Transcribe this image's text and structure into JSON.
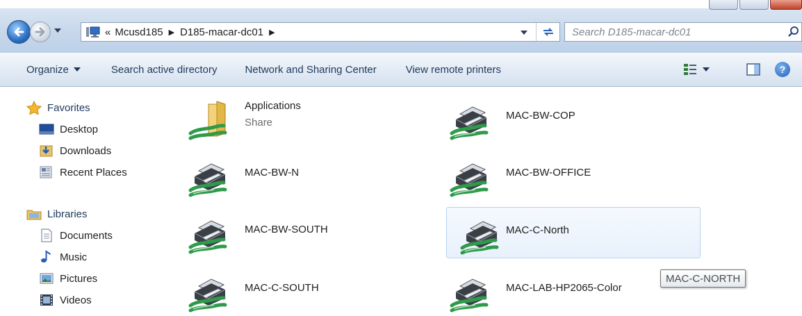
{
  "window": {
    "breadcrumb": {
      "overflow": "«",
      "items": [
        "Mcusd185",
        "D185-macar-dc01"
      ]
    },
    "search_placeholder": "Search D185-macar-dc01"
  },
  "toolbar": {
    "organize": "Organize",
    "search_ad": "Search active directory",
    "network": "Network and Sharing Center",
    "remote_printers": "View remote printers",
    "help": "?"
  },
  "navpane": {
    "favorites": {
      "label": "Favorites",
      "items": [
        "Desktop",
        "Downloads",
        "Recent Places"
      ]
    },
    "libraries": {
      "label": "Libraries",
      "items": [
        "Documents",
        "Music",
        "Pictures",
        "Videos"
      ]
    }
  },
  "items": [
    {
      "name": "Applications",
      "sub": "Share",
      "type": "share-folder"
    },
    {
      "name": "MAC-BW-COP",
      "type": "printer"
    },
    {
      "name": "MAC-BW-N",
      "type": "printer"
    },
    {
      "name": "MAC-BW-OFFICE",
      "type": "printer"
    },
    {
      "name": "MAC-BW-SOUTH",
      "type": "printer"
    },
    {
      "name": "MAC-C-North",
      "type": "printer",
      "selected": true
    },
    {
      "name": "MAC-C-SOUTH",
      "type": "printer"
    },
    {
      "name": "MAC-LAB-HP2065-Color",
      "type": "printer"
    }
  ],
  "tooltip": "MAC-C-NORTH",
  "colors": {
    "accent": "#1e395b",
    "selection": "#e8f1fc",
    "selection_border": "#b7d2f2"
  }
}
